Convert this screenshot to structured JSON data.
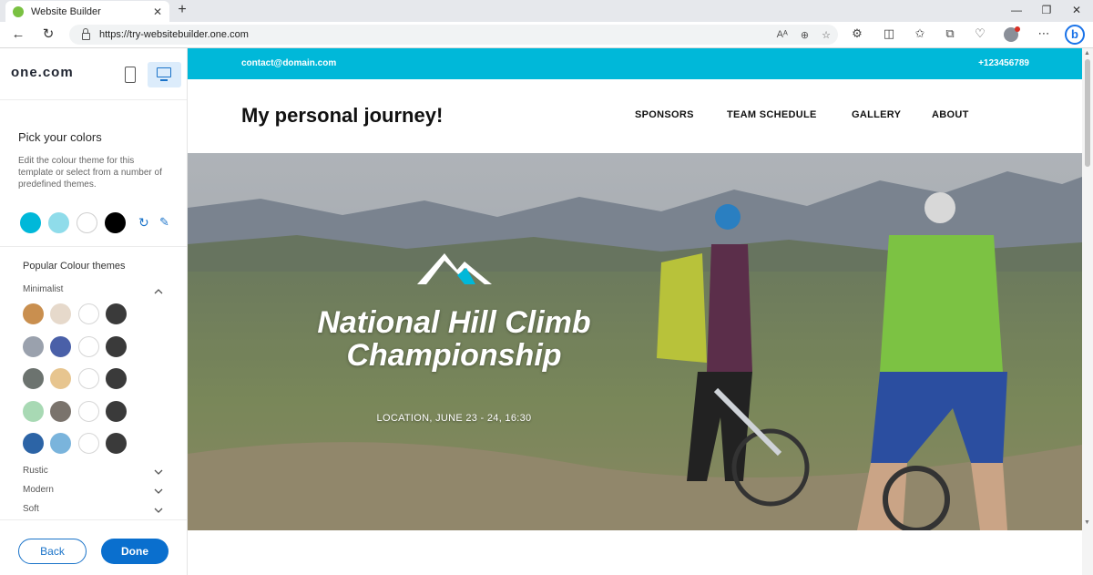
{
  "browser": {
    "tab_title": "Website Builder",
    "tab_close": "✕",
    "new_tab": "+",
    "url": "https://try-websitebuilder.one.com",
    "window_controls": [
      "—",
      "❐",
      "✕"
    ],
    "back_icon": "←",
    "reload_icon": "↻",
    "url_icons": [
      "Aᴬ",
      "⊕",
      "☆"
    ],
    "toolbar_icons": [
      "⚙",
      "◫",
      "✩",
      "⧉",
      "♡",
      "⋯"
    ],
    "bing_letter": "b"
  },
  "panel": {
    "logo": "one.com",
    "pick_title": "Pick your colors",
    "pick_desc": "Edit the colour theme for this template or select from a number of predefined themes.",
    "current_colors": [
      "#00b8d9",
      "#8fdcea",
      "#ffffff",
      "#000000"
    ],
    "reset_icon": "↻",
    "edit_icon": "✎",
    "themes_title": "Popular Colour themes",
    "groups": [
      {
        "label": "Minimalist",
        "expanded": true
      },
      {
        "label": "Rustic",
        "expanded": false
      },
      {
        "label": "Modern",
        "expanded": false
      },
      {
        "label": "Soft",
        "expanded": false
      }
    ],
    "minimalist_rows": [
      [
        "#c98f4f",
        "#e6d9cb",
        "#ffffff",
        "#3a3a3a"
      ],
      [
        "#9aa1ad",
        "#4a60a8",
        "#ffffff",
        "#3a3a3a"
      ],
      [
        "#6c736f",
        "#e7c58f",
        "#ffffff",
        "#3a3a3a"
      ],
      [
        "#a8d9b4",
        "#7a736c",
        "#ffffff",
        "#3a3a3a"
      ],
      [
        "#2c64a6",
        "#7ab4dc",
        "#ffffff",
        "#3a3a3a"
      ]
    ],
    "back_label": "Back",
    "done_label": "Done"
  },
  "site": {
    "email": "contact@domain.com",
    "phone": "+123456789",
    "title": "My personal journey!",
    "nav": [
      "SPONSORS",
      "TEAM SCHEDULE",
      "GALLERY",
      "ABOUT"
    ],
    "hero_title_line1": "National Hill Climb",
    "hero_title_line2": "Championship",
    "hero_subtitle": "LOCATION, JUNE 23 - 24, 16:30",
    "accent": "#00b8d9"
  }
}
